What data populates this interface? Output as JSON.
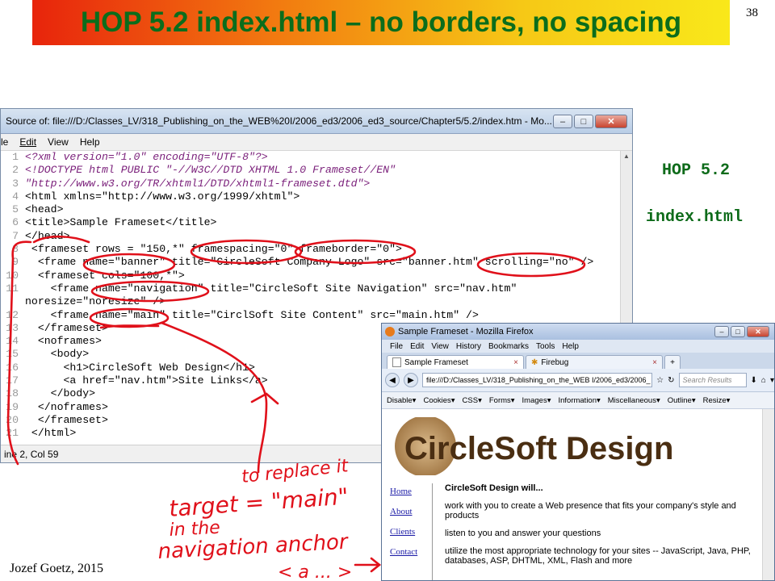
{
  "slide": {
    "title": "HOP 5.2 index.html – no borders, no spacing",
    "page_number": "38",
    "side_label_1": "HOP 5.2",
    "side_label_2": "index.html",
    "footer": "Jozef Goetz, 2015"
  },
  "colors": {
    "title_text": "#0b6d1c",
    "annotation_red": "#e0101a",
    "side_label": "#0e6b1a"
  },
  "source_window": {
    "title": "Source of: file:///D:/Classes_LV/318_Publishing_on_the_WEB%20I/2006_ed3/2006_ed3_source/Chapter5/5.2/index.htm - Mo...",
    "menu": [
      "le",
      "Edit",
      "View",
      "Help"
    ],
    "status": "ine 2, Col 59",
    "buttons": {
      "minimize": "–",
      "maximize": "□",
      "close": "✕"
    },
    "lines": [
      {
        "n": "1",
        "text": "<?xml version=\"1.0\" encoding=\"UTF-8\"?>"
      },
      {
        "n": "2",
        "text": "<!DOCTYPE html PUBLIC \"-//W3C//DTD XHTML 1.0 Frameset//EN\""
      },
      {
        "n": "3",
        "text": "\"http://www.w3.org/TR/xhtml1/DTD/xhtml1-frameset.dtd\">"
      },
      {
        "n": "4",
        "text": "<html xmlns=\"http://www.w3.org/1999/xhtml\">"
      },
      {
        "n": "5",
        "text": "<head>"
      },
      {
        "n": "6",
        "text": "<title>Sample Frameset</title>"
      },
      {
        "n": "7",
        "text": "</head>"
      },
      {
        "n": "8",
        "text": " <frameset rows = \"150,*\" framespacing=\"0\" frameborder=\"0\">"
      },
      {
        "n": "9",
        "text": "  <frame name=\"banner\" title=\"CircleSoft Company Logo\" src=\"banner.htm\" scrolling=\"no\" />"
      },
      {
        "n": "10",
        "text": "  <frameset cols=\"100,*\">"
      },
      {
        "n": "11",
        "text": "    <frame name=\"navigation\" title=\"CircleSoft Site Navigation\" src=\"nav.htm\""
      },
      {
        "n": "",
        "text": "noresize=\"noresize\" />"
      },
      {
        "n": "12",
        "text": "    <frame name=\"main\" title=\"CirclSoft Site Content\" src=\"main.htm\" />"
      },
      {
        "n": "13",
        "text": "  </frameset>"
      },
      {
        "n": "14",
        "text": "  <noframes>"
      },
      {
        "n": "15",
        "text": "    <body>"
      },
      {
        "n": "16",
        "text": "      <h1>CircleSoft Web Design</h1>"
      },
      {
        "n": "17",
        "text": "      <a href=\"nav.htm\">Site Links</a>"
      },
      {
        "n": "18",
        "text": "    </body>"
      },
      {
        "n": "19",
        "text": "  </noframes>"
      },
      {
        "n": "20",
        "text": "  </frameset>"
      },
      {
        "n": "21",
        "text": " </html>"
      }
    ]
  },
  "firefox_window": {
    "title": "Sample Frameset - Mozilla Firefox",
    "menu": [
      "File",
      "Edit",
      "View",
      "History",
      "Bookmarks",
      "Tools",
      "Help"
    ],
    "tabs": [
      {
        "label": "Sample Frameset",
        "active": true
      },
      {
        "label": "Firebug",
        "active": false
      }
    ],
    "new_tab": "+",
    "url": "file:///D:/Classes_LV/318_Publishing_on_the_WEB I/2006_ed3/2006_",
    "search_placeholder": "Search Results",
    "webdev_toolbar": [
      "Disable▾",
      "Cookies▾",
      "CSS▾",
      "Forms▾",
      "Images▾",
      "Information▾",
      "Miscellaneous▾",
      "Outline▾",
      "Resize▾"
    ],
    "logo_text": "CircleSoft Design",
    "nav_links": [
      "Home",
      "About",
      "Clients",
      "Contact"
    ],
    "main": {
      "heading": "CircleSoft Design will...",
      "paragraphs": [
        "work with you to create a Web presence that fits your company's style and products",
        "listen to you and answer your questions",
        "utilize the most appropriate technology for your sites -- JavaScript, Java, PHP, databases, ASP, DHTML, XML, Flash and more"
      ]
    }
  },
  "handwriting": {
    "line1": "to replace it",
    "line2": "target = \"main\"",
    "line3": "in the",
    "line4": "navigation anchor",
    "line5": "< a ... >"
  }
}
